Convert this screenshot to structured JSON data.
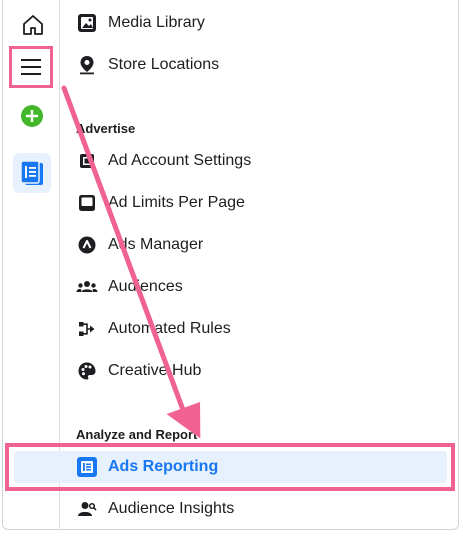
{
  "rail": {
    "items": [
      {
        "name": "home",
        "icon": "home-icon"
      },
      {
        "name": "menu",
        "icon": "hamburger-menu-icon"
      },
      {
        "name": "create",
        "icon": "plus-circle-icon"
      },
      {
        "name": "ads-reporting",
        "icon": "ads-reporting-icon"
      }
    ]
  },
  "menu": {
    "top_items": [
      {
        "label": "Media Library",
        "icon": "media-library-icon"
      },
      {
        "label": "Store Locations",
        "icon": "map-pin-icon"
      }
    ],
    "advertise": {
      "heading": "Advertise",
      "items": [
        {
          "label": "Ad Account Settings",
          "icon": "ad-account-settings-icon"
        },
        {
          "label": "Ad Limits Per Page",
          "icon": "ad-limits-icon"
        },
        {
          "label": "Ads Manager",
          "icon": "ads-manager-icon"
        },
        {
          "label": "Audiences",
          "icon": "audiences-icon"
        },
        {
          "label": "Automated Rules",
          "icon": "automated-rules-icon"
        },
        {
          "label": "Creative Hub",
          "icon": "palette-icon"
        }
      ]
    },
    "analyze": {
      "heading": "Analyze and Report",
      "items": [
        {
          "label": "Ads Reporting",
          "icon": "ads-reporting-icon",
          "selected": true
        },
        {
          "label": "Audience Insights",
          "icon": "audience-insights-icon"
        }
      ]
    }
  },
  "colors": {
    "highlight": "#f06292",
    "accent": "#1877f2",
    "selected_bg": "#e7f0fd",
    "add_button": "#42b72a"
  }
}
